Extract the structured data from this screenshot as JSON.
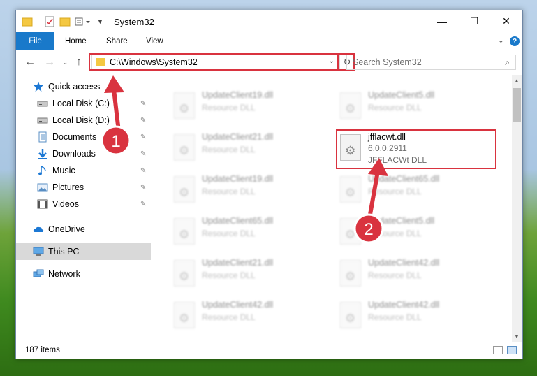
{
  "window": {
    "title": "System32"
  },
  "window_controls": {
    "minimize": "—",
    "maximize": "☐",
    "close": "✕"
  },
  "ribbon": {
    "file": "File",
    "home": "Home",
    "share": "Share",
    "view": "View"
  },
  "address": {
    "path": "C:\\Windows\\System32"
  },
  "search": {
    "placeholder": "Search System32"
  },
  "sidebar": {
    "items": [
      {
        "label": "Quick access",
        "icon": "star-icon"
      },
      {
        "label": "Local Disk (C:)",
        "icon": "drive-icon"
      },
      {
        "label": "Local Disk (D:)",
        "icon": "drive-icon"
      },
      {
        "label": "Documents",
        "icon": "documents-icon"
      },
      {
        "label": "Downloads",
        "icon": "download-icon"
      },
      {
        "label": "Music",
        "icon": "music-icon"
      },
      {
        "label": "Pictures",
        "icon": "pictures-icon"
      },
      {
        "label": "Videos",
        "icon": "videos-icon"
      },
      {
        "label": "OneDrive",
        "icon": "cloud-icon"
      },
      {
        "label": "This PC",
        "icon": "computer-icon"
      },
      {
        "label": "Network",
        "icon": "network-icon"
      }
    ]
  },
  "files": [
    {
      "name": "UpdateClient19.dll",
      "desc": "Resource DLL"
    },
    {
      "name": "UpdateClient5.dll",
      "desc": "Resource DLL"
    },
    {
      "name": "UpdateClient21.dll",
      "desc": "Resource DLL"
    },
    {
      "name": "jfflacwt.dll",
      "version": "6.0.0.2911",
      "desc": "JFFLACWt DLL"
    },
    {
      "name": "UpdateClient19.dll",
      "desc": "Resource DLL"
    },
    {
      "name": "UpdateClient65.dll",
      "desc": "Resource DLL"
    },
    {
      "name": "UpdateClient65.dll",
      "desc": "Resource DLL"
    },
    {
      "name": "UpdateClient5.dll",
      "desc": "Resource DLL"
    },
    {
      "name": "UpdateClient21.dll",
      "desc": "Resource DLL"
    },
    {
      "name": "UpdateClient42.dll",
      "desc": "Resource DLL"
    },
    {
      "name": "UpdateClient42.dll",
      "desc": "Resource DLL"
    },
    {
      "name": "UpdateClient42.dll",
      "desc": "Resource DLL"
    }
  ],
  "status": {
    "item_count": "187 items"
  },
  "annotations": {
    "step1": "1",
    "step2": "2",
    "color": "#d9333f"
  }
}
